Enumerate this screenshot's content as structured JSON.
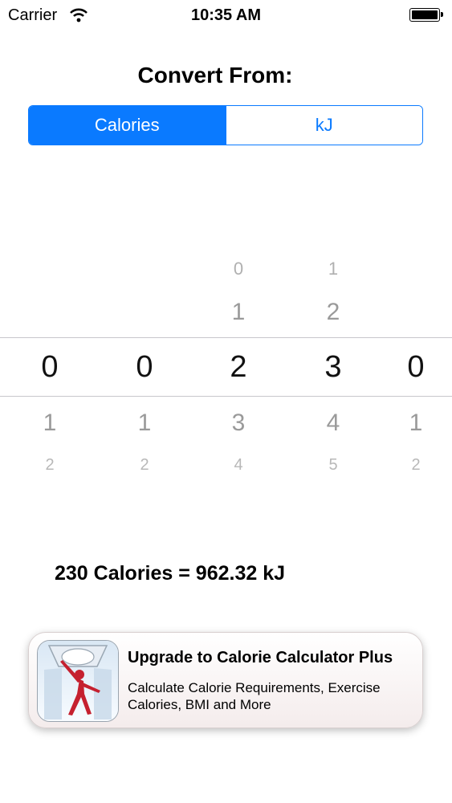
{
  "status_bar": {
    "carrier": "Carrier",
    "time": "10:35 AM"
  },
  "converter": {
    "heading": "Convert From:",
    "units": [
      {
        "label": "Calories",
        "selected": true
      },
      {
        "label": "kJ",
        "selected": false
      }
    ]
  },
  "picker": {
    "columns": [
      {
        "above": [
          "",
          ""
        ],
        "value": "0",
        "below": [
          "1",
          "2"
        ]
      },
      {
        "above": [
          "",
          ""
        ],
        "value": "0",
        "below": [
          "1",
          "2"
        ]
      },
      {
        "above": [
          "0",
          "1"
        ],
        "value": "2",
        "below": [
          "3",
          "4"
        ]
      },
      {
        "above": [
          "1",
          "2"
        ],
        "value": "3",
        "below": [
          "4",
          "5"
        ]
      },
      {
        "above": [
          "",
          ""
        ],
        "value": "0",
        "below": [
          "1",
          "2"
        ]
      }
    ]
  },
  "result": {
    "text": "230 Calories = 962.32 kJ"
  },
  "upgrade": {
    "title": "Upgrade to Calorie Calculator Plus",
    "subtitle": "Calculate Calorie Requirements, Exercise Calories, BMI and More"
  },
  "colors": {
    "accent": "#0a7aff"
  }
}
